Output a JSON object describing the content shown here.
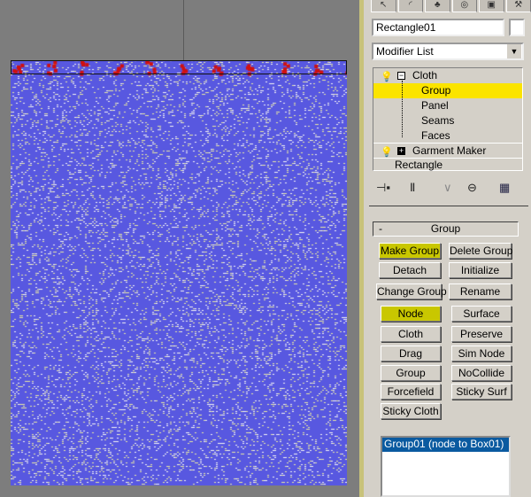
{
  "colors": {
    "mesh": "#5858e0",
    "highlight": "#fbe400",
    "active_button": "#c9c700",
    "selection": "#0a5aa0"
  },
  "command_tabs": [
    "create-icon",
    "modify-icon",
    "hierarchy-icon",
    "motion-icon",
    "display-icon",
    "utilities-icon"
  ],
  "object_name": "Rectangle01",
  "modifier_list": "Modifier List",
  "stack": {
    "cloth": "Cloth",
    "sub": [
      "Group",
      "Panel",
      "Seams",
      "Faces"
    ],
    "selected": "Group",
    "garment": "Garment Maker",
    "base": "Rectangle"
  },
  "rollout": {
    "collapse": "-",
    "title": "Group"
  },
  "buttons": {
    "make_group": "Make Group",
    "delete_group": "Delete Group",
    "detach": "Detach",
    "initialize": "Initialize",
    "change_group": "Change Group",
    "rename": "Rename",
    "node": "Node",
    "surface": "Surface",
    "cloth": "Cloth",
    "preserve": "Preserve",
    "drag": "Drag",
    "sim_node": "Sim Node",
    "group": "Group",
    "nocollide": "NoCollide",
    "forcefield": "Forcefield",
    "sticky_surf": "Sticky Surf",
    "sticky_cloth": "Sticky Cloth"
  },
  "group_list": [
    "Group01 (node  to  Box01)"
  ]
}
